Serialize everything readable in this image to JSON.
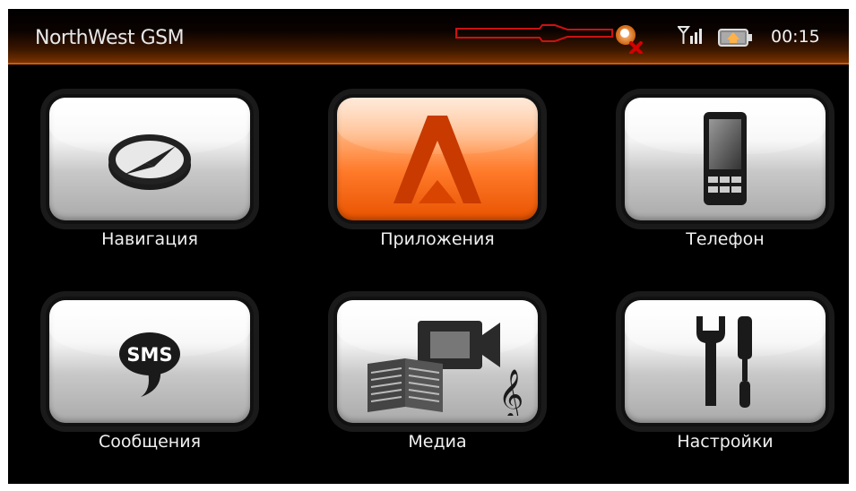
{
  "header": {
    "title": "NorthWest GSM",
    "time": "00:15",
    "status_icons": [
      "gps-off-icon",
      "signal-icon",
      "battery-icon"
    ]
  },
  "tiles": [
    {
      "label": "Навигация",
      "icon": "compass-icon",
      "active": false
    },
    {
      "label": "Приложения",
      "icon": "apps-logo-icon",
      "active": true
    },
    {
      "label": "Телефон",
      "icon": "phone-icon",
      "active": false
    },
    {
      "label": "Сообщения",
      "icon": "sms-icon",
      "active": false
    },
    {
      "label": "Медиа",
      "icon": "media-icon",
      "active": false
    },
    {
      "label": "Настройки",
      "icon": "tools-icon",
      "active": false
    }
  ],
  "colors": {
    "accent": "#ff7a2a",
    "background": "#000000",
    "annotation": "#cc1111"
  }
}
